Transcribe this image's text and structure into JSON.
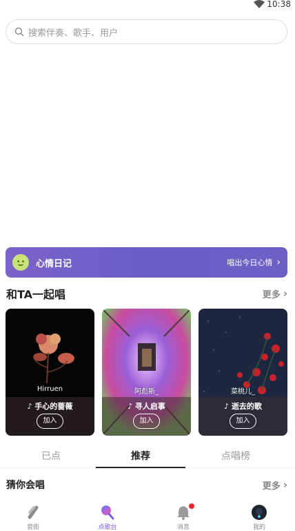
{
  "status": {
    "time": "10:38"
  },
  "search": {
    "placeholder": "搜索伴奏、歌手、用户"
  },
  "mood_banner": {
    "title": "心情日记",
    "cta": "唱出今日心情"
  },
  "sing_together": {
    "heading": "和TA一起唱",
    "more": "更多",
    "cards": [
      {
        "singer": "Hirruen",
        "song": "手心的蔷薇",
        "join": "加入"
      },
      {
        "singer": "阿彪斯_",
        "song": "寻人启事",
        "join": "加入"
      },
      {
        "singer": "菜桃儿_",
        "song": "逝去的歌",
        "join": "加入"
      }
    ]
  },
  "tabs": {
    "items": [
      "已点",
      "推荐",
      "点唱榜"
    ],
    "active": "推荐"
  },
  "guess": {
    "heading": "猜你会唱",
    "more": "更多"
  },
  "bottom_nav": {
    "items": [
      {
        "label": "音街",
        "icon": "music-street-icon"
      },
      {
        "label": "点歌台",
        "icon": "microphone-icon"
      },
      {
        "label": "消息",
        "icon": "bell-icon"
      },
      {
        "label": "我的",
        "icon": "avatar-icon"
      }
    ],
    "active": "点歌台"
  },
  "colors": {
    "accent": "#7a5be0",
    "badge": "#e8242c",
    "banner": "#6a5ec8"
  }
}
